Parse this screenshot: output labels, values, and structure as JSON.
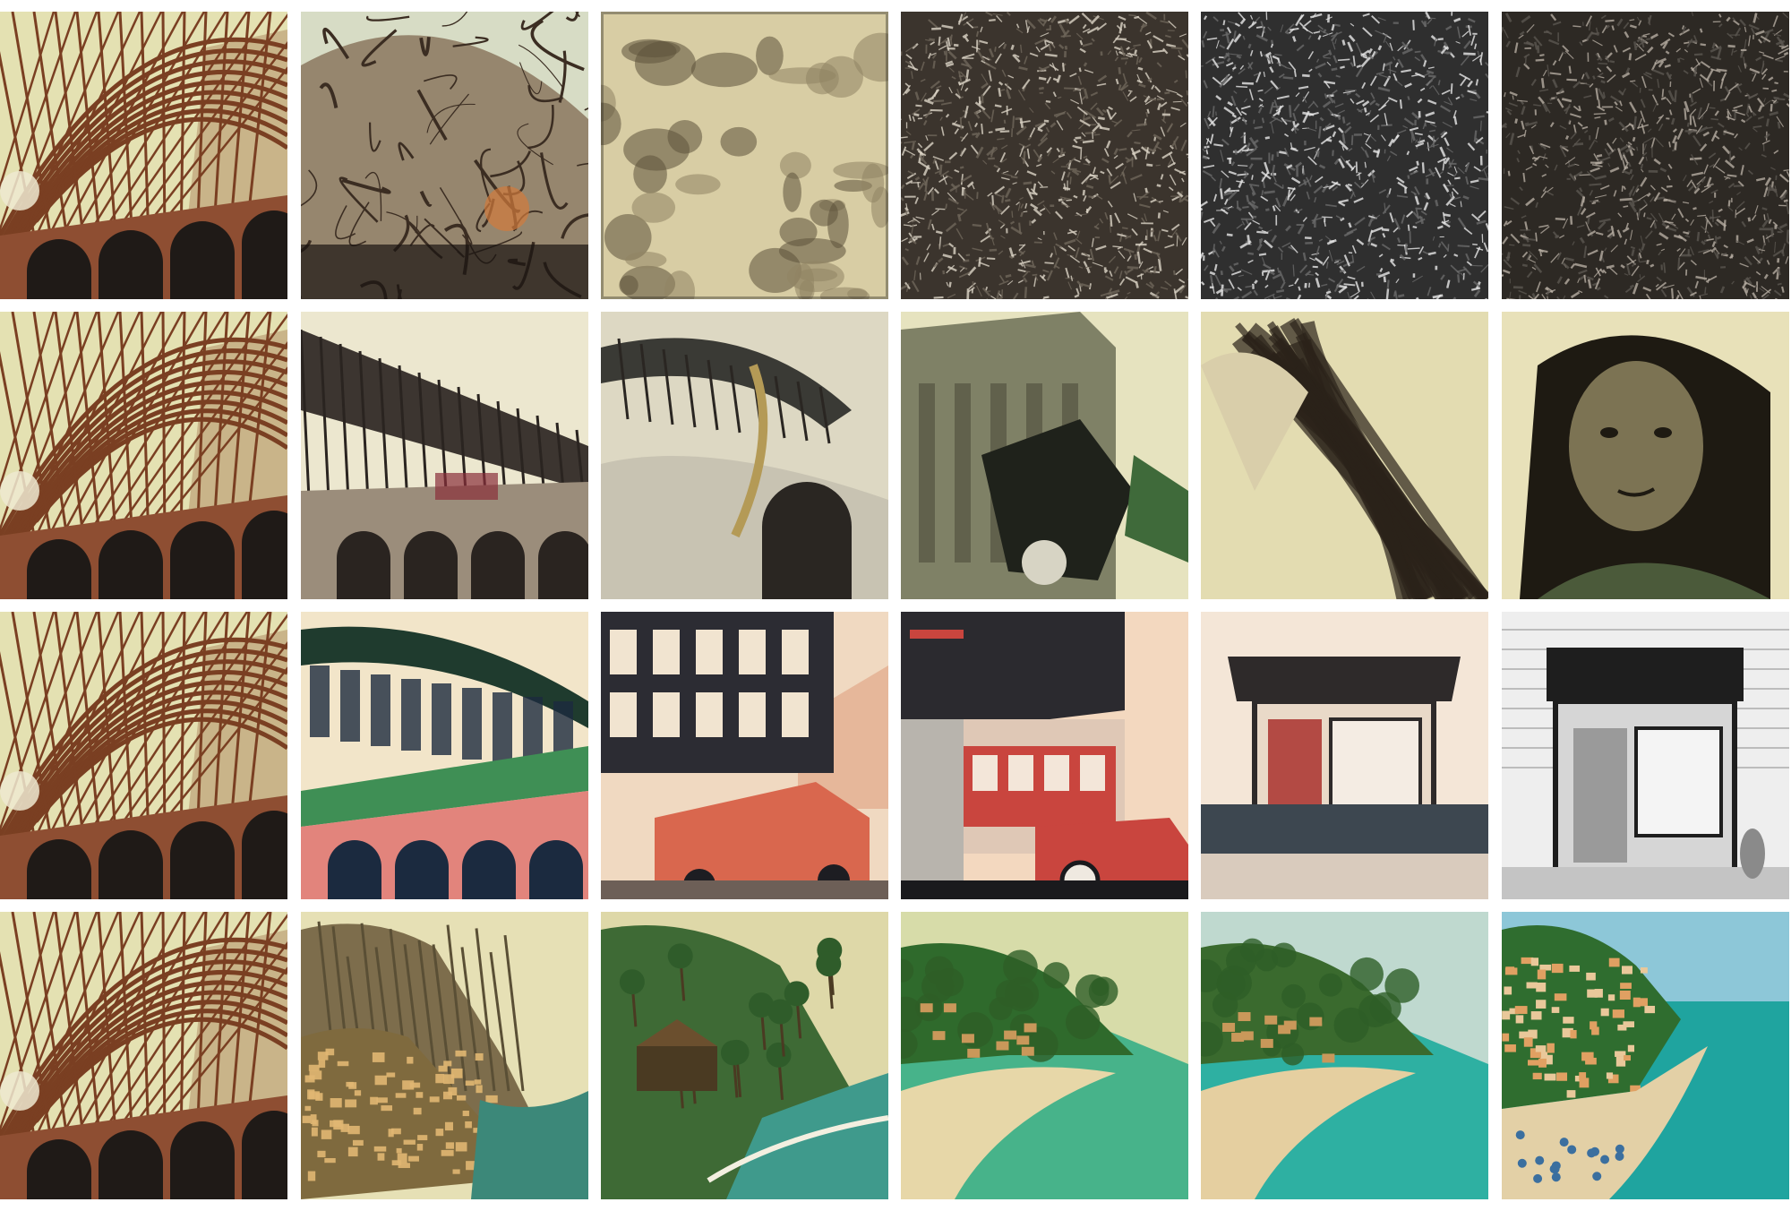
{
  "grid": {
    "rows": 4,
    "cols": 6,
    "background": "#ffffff"
  },
  "tiles": [
    {
      "row": 0,
      "col": 0,
      "name": "tile-bridge-source-row1",
      "kind": "bridge",
      "sky": "#e4e1b2",
      "frame": "#7a3f22",
      "base": "#8e4e32",
      "dark": "#1f1a17"
    },
    {
      "row": 0,
      "col": 1,
      "name": "tile-wreckage-tangle",
      "kind": "tangle",
      "sky": "#d7dcc5",
      "frame": "#3b2d22",
      "base": "#6b4d34",
      "dark": "#1a1411"
    },
    {
      "row": 0,
      "col": 2,
      "name": "tile-sepia-figures",
      "kind": "sepia",
      "sky": "#d8cda4",
      "frame": "#5d523a",
      "base": "#8f8363",
      "dark": "#2e2a22"
    },
    {
      "row": 0,
      "col": 3,
      "name": "tile-noise-texture-brown",
      "kind": "noise",
      "sky": "#6f665a",
      "frame": "#dcd4c6",
      "base": "#3b342d",
      "dark": "#141210"
    },
    {
      "row": 0,
      "col": 4,
      "name": "tile-noise-texture-gray",
      "kind": "noise",
      "sky": "#6a6a6a",
      "frame": "#e8e8e8",
      "base": "#2f2f2f",
      "dark": "#0d0d0d"
    },
    {
      "row": 0,
      "col": 5,
      "name": "tile-noise-texture-mixed",
      "kind": "noise",
      "sky": "#5b5650",
      "frame": "#b6ada2",
      "base": "#2d2924",
      "dark": "#101010"
    },
    {
      "row": 1,
      "col": 0,
      "name": "tile-bridge-source-row2",
      "kind": "bridge",
      "sky": "#e4e1b2",
      "frame": "#7a3f22",
      "base": "#8e4e32",
      "dark": "#1f1a17"
    },
    {
      "row": 1,
      "col": 1,
      "name": "tile-stadium-ruins",
      "kind": "stadium",
      "sky": "#ece7cf",
      "frame": "#3c3530",
      "base": "#9b8d7b",
      "dark": "#2a2420"
    },
    {
      "row": 1,
      "col": 2,
      "name": "tile-wave-wreck",
      "kind": "wreck",
      "sky": "#ddd8c3",
      "frame": "#3a3a35",
      "base": "#c8c3b2",
      "dark": "#2a2622"
    },
    {
      "row": 1,
      "col": 3,
      "name": "tile-cathedral-robot",
      "kind": "robot",
      "sky": "#e6e3bf",
      "frame": "#4c4c3a",
      "base": "#7f8166",
      "dark": "#1f221b"
    },
    {
      "row": 1,
      "col": 4,
      "name": "tile-flowing-hair",
      "kind": "hair",
      "sky": "#e3dcb1",
      "frame": "#2b221a",
      "base": "#d9ceaa",
      "dark": "#150f0b"
    },
    {
      "row": 1,
      "col": 5,
      "name": "tile-portrait",
      "kind": "portrait",
      "sky": "#e8e1b9",
      "frame": "#4e4a33",
      "base": "#7c7353",
      "dark": "#1e1a12"
    },
    {
      "row": 2,
      "col": 0,
      "name": "tile-bridge-source-row3",
      "kind": "bridge",
      "sky": "#e4e1b2",
      "frame": "#7a3f22",
      "base": "#8e4e32",
      "dark": "#1f1a17"
    },
    {
      "row": 2,
      "col": 1,
      "name": "tile-illustrated-station",
      "kind": "station",
      "sky": "#f2e5c9",
      "frame": "#1f3b2e",
      "base": "#e2847c",
      "dark": "#1b2a3f"
    },
    {
      "row": 2,
      "col": 2,
      "name": "tile-illustrated-street-van",
      "kind": "street",
      "sky": "#f0d9c1",
      "frame": "#2c2c33",
      "base": "#d9674e",
      "dark": "#1d1d22"
    },
    {
      "row": 2,
      "col": 3,
      "name": "tile-illustrated-bus",
      "kind": "bus",
      "sky": "#f3d8bf",
      "frame": "#2b2a2f",
      "base": "#c9453e",
      "dark": "#1a1a1d"
    },
    {
      "row": 2,
      "col": 4,
      "name": "tile-illustrated-shopfront",
      "kind": "shop",
      "sky": "#f4e6d7",
      "frame": "#2e2a2a",
      "base": "#b34a44",
      "dark": "#3d4750"
    },
    {
      "row": 2,
      "col": 5,
      "name": "tile-grayscale-shopfront",
      "kind": "shopgray",
      "sky": "#eeeeee",
      "frame": "#1e1e1e",
      "base": "#9a9a9a",
      "dark": "#0f0f0f"
    },
    {
      "row": 3,
      "col": 0,
      "name": "tile-bridge-source-row4",
      "kind": "bridge",
      "sky": "#e4e1b2",
      "frame": "#7a3f22",
      "base": "#8e4e32",
      "dark": "#1f1a17"
    },
    {
      "row": 3,
      "col": 1,
      "name": "tile-cliff-village",
      "kind": "cliff",
      "sky": "#e6e0b5",
      "frame": "#7d6d4c",
      "base": "#3c8879",
      "dark": "#3b3a26"
    },
    {
      "row": 3,
      "col": 2,
      "name": "tile-tropical-village",
      "kind": "tropic",
      "sky": "#ded8a8",
      "frame": "#3e6a35",
      "base": "#3f9a8c",
      "dark": "#4a3a22"
    },
    {
      "row": 3,
      "col": 3,
      "name": "tile-beach-cove",
      "kind": "beach",
      "sky": "#d7dca9",
      "frame": "#2f6a2c",
      "base": "#47b38a",
      "dark": "#e7d7a8"
    },
    {
      "row": 3,
      "col": 4,
      "name": "tile-beach-resort",
      "kind": "beach",
      "sky": "#bfd9cf",
      "frame": "#3a6a2e",
      "base": "#2eb0a2",
      "dark": "#e5cfa0"
    },
    {
      "row": 3,
      "col": 5,
      "name": "tile-coastal-town",
      "kind": "coast",
      "sky": "#8dc7d8",
      "frame": "#2f6d2f",
      "base": "#1fa49f",
      "dark": "#e3d0a6"
    }
  ]
}
